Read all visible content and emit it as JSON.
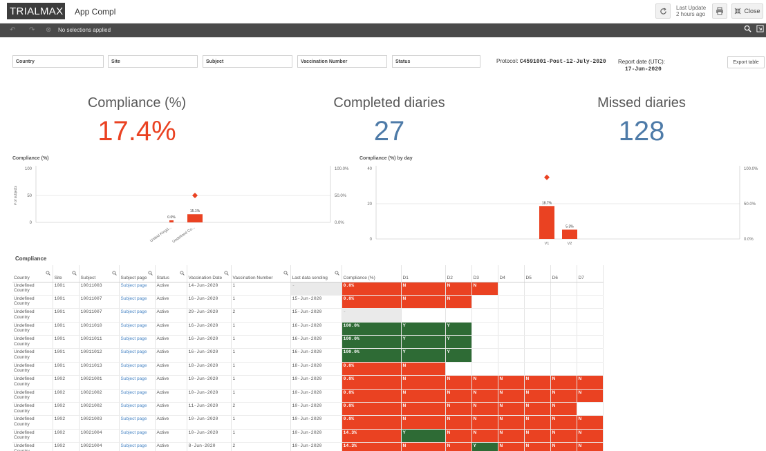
{
  "header": {
    "logo": "TRIALMAX",
    "app_title": "App Compl",
    "last_update_line1": "Last Update",
    "last_update_line2": "2 hours ago",
    "close_label": "Close"
  },
  "selection_bar": {
    "text": "No selections applied"
  },
  "filters": [
    "Country",
    "Site",
    "Subject",
    "Vaccination Number",
    "Status"
  ],
  "protocol": {
    "label": "Protocol:",
    "value": "C4591001-Post-12-July-2020"
  },
  "report_date": {
    "label": "Report date (UTC):",
    "value": "17-Jun-2020"
  },
  "export_label": "Export table",
  "kpis": [
    {
      "title": "Compliance (%)",
      "value": "17.4%",
      "color": "#ea4222"
    },
    {
      "title": "Completed diaries",
      "value": "27",
      "color": "#4e7ba8"
    },
    {
      "title": "Missed diaries",
      "value": "128",
      "color": "#4e7ba8"
    }
  ],
  "chart_data": [
    {
      "type": "bar",
      "title": "Compliance (%)",
      "ylabel": "# of subjects",
      "categories": [
        "United Kingd...",
        "Undefined Co..."
      ],
      "values": [
        0,
        15.1
      ],
      "data_labels": [
        "0.0%",
        "15.1%"
      ],
      "marker_value": 50,
      "left_ticks": [
        "100",
        "50",
        "0"
      ],
      "right_ticks": [
        "100.0%",
        "50.0%",
        "0.0%"
      ],
      "ylim": [
        0,
        100
      ]
    },
    {
      "type": "bar",
      "title": "Compliance (%) by day",
      "categories": [
        "V1",
        "V2"
      ],
      "values": [
        18.7,
        5.3
      ],
      "data_labels": [
        "18.7%",
        "5.3%"
      ],
      "marker_value": 35,
      "left_ticks": [
        "40",
        "20",
        "0"
      ],
      "right_ticks": [
        "100.0%",
        "50.0%",
        "0.0%"
      ],
      "ylim": [
        0,
        40
      ]
    }
  ],
  "table": {
    "title": "Compliance",
    "columns": [
      "Country",
      "Site",
      "Subject",
      "Subject page",
      "Status",
      "Vaccination Date",
      "Vaccination Number",
      "Last data sending",
      "Compliance (%)",
      "D1",
      "D2",
      "D3",
      "D4",
      "D5",
      "D6",
      "D7"
    ],
    "rows": [
      {
        "country": "Undefined Country",
        "site": "1001",
        "subject": "10011003",
        "page": "Subject page",
        "status": "Active",
        "vdate": "14-Jun-2020",
        "vnum": "1",
        "last": "-",
        "comp": "0.0%",
        "d": [
          "N",
          "N",
          "N",
          "",
          "",
          "",
          ""
        ]
      },
      {
        "country": "Undefined Country",
        "site": "1001",
        "subject": "10011007",
        "page": "Subject page",
        "status": "Active",
        "vdate": "16-Jun-2020",
        "vnum": "1",
        "last": "15-Jun-2020",
        "comp": "0.0%",
        "d": [
          "N",
          "N",
          "",
          "",
          "",
          "",
          ""
        ]
      },
      {
        "country": "Undefined Country",
        "site": "1001",
        "subject": "10011007",
        "page": "Subject page",
        "status": "Active",
        "vdate": "29-Jun-2020",
        "vnum": "2",
        "last": "15-Jun-2020",
        "comp": "-",
        "d": [
          "",
          "",
          "",
          "",
          "",
          "",
          ""
        ]
      },
      {
        "country": "Undefined Country",
        "site": "1001",
        "subject": "10011010",
        "page": "Subject page",
        "status": "Active",
        "vdate": "16-Jun-2020",
        "vnum": "1",
        "last": "16-Jun-2020",
        "comp": "100.0%",
        "d": [
          "Y",
          "Y",
          "",
          "",
          "",
          "",
          ""
        ]
      },
      {
        "country": "Undefined Country",
        "site": "1001",
        "subject": "10011011",
        "page": "Subject page",
        "status": "Active",
        "vdate": "16-Jun-2020",
        "vnum": "1",
        "last": "16-Jun-2020",
        "comp": "100.0%",
        "d": [
          "Y",
          "Y",
          "",
          "",
          "",
          "",
          ""
        ]
      },
      {
        "country": "Undefined Country",
        "site": "1001",
        "subject": "10011012",
        "page": "Subject page",
        "status": "Active",
        "vdate": "16-Jun-2020",
        "vnum": "1",
        "last": "16-Jun-2020",
        "comp": "100.0%",
        "d": [
          "Y",
          "Y",
          "",
          "",
          "",
          "",
          ""
        ]
      },
      {
        "country": "Undefined Country",
        "site": "1001",
        "subject": "10011013",
        "page": "Subject page",
        "status": "Active",
        "vdate": "18-Jun-2020",
        "vnum": "1",
        "last": "18-Jun-2020",
        "comp": "0.0%",
        "d": [
          "N",
          "",
          "",
          "",
          "",
          "",
          ""
        ]
      },
      {
        "country": "Undefined Country",
        "site": "1002",
        "subject": "10021001",
        "page": "Subject page",
        "status": "Active",
        "vdate": "10-Jun-2020",
        "vnum": "1",
        "last": "10-Jun-2020",
        "comp": "0.0%",
        "d": [
          "N",
          "N",
          "N",
          "N",
          "N",
          "N",
          "N"
        ]
      },
      {
        "country": "Undefined Country",
        "site": "1002",
        "subject": "10021002",
        "page": "Subject page",
        "status": "Active",
        "vdate": "10-Jun-2020",
        "vnum": "1",
        "last": "10-Jun-2020",
        "comp": "0.0%",
        "d": [
          "N",
          "N",
          "N",
          "N",
          "N",
          "N",
          "N"
        ]
      },
      {
        "country": "Undefined Country",
        "site": "1002",
        "subject": "10021002",
        "page": "Subject page",
        "status": "Active",
        "vdate": "11-Jun-2020",
        "vnum": "2",
        "last": "10-Jun-2020",
        "comp": "0.0%",
        "d": [
          "N",
          "N",
          "N",
          "N",
          "N",
          "N",
          ""
        ]
      },
      {
        "country": "Undefined Country",
        "site": "1002",
        "subject": "10021003",
        "page": "Subject page",
        "status": "Active",
        "vdate": "10-Jun-2020",
        "vnum": "1",
        "last": "10-Jun-2020",
        "comp": "0.0%",
        "d": [
          "N",
          "N",
          "N",
          "N",
          "N",
          "N",
          "N"
        ]
      },
      {
        "country": "Undefined Country",
        "site": "1002",
        "subject": "10021004",
        "page": "Subject page",
        "status": "Active",
        "vdate": "10-Jun-2020",
        "vnum": "1",
        "last": "10-Jun-2020",
        "comp": "14.3%",
        "d": [
          "Y",
          "N",
          "N",
          "N",
          "N",
          "N",
          "N"
        ]
      },
      {
        "country": "Undefined Country",
        "site": "1002",
        "subject": "10021004",
        "page": "Subject page",
        "status": "Active",
        "vdate": "8-Jun-2020",
        "vnum": "2",
        "last": "10-Jun-2020",
        "comp": "14.3%",
        "d": [
          "N",
          "N",
          "Y",
          "N",
          "N",
          "N",
          "N"
        ]
      }
    ]
  }
}
